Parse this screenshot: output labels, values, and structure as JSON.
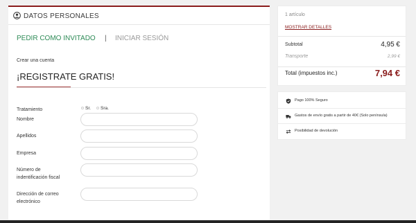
{
  "personal": {
    "title": "DATOS PERSONALES",
    "tabs": {
      "guest": "PEDIR COMO INVITADO",
      "separator": "|",
      "login": "INICIAR SESIÓN"
    },
    "create_account": "Crear una cuenta",
    "headline": "¡REGISTRATE GRATIS!",
    "form": {
      "title_label": "Tratamiento",
      "title_options": [
        "Sr.",
        "Sra."
      ],
      "nombre_label": "Nombre",
      "apellidos_label": "Apellidos",
      "empresa_label": "Empresa",
      "nif_label_1": "Número de",
      "nif_label_2": "indentificación fiscal",
      "email_label_1": "Dirección de correo",
      "email_label_2": "electrónico"
    }
  },
  "cart": {
    "count": "1 artículo",
    "show_details": "MOSTRAR DETALLES",
    "subtotal_label": "Subtotal",
    "subtotal_value": "4,95 €",
    "shipping_label": "Transporte",
    "shipping_value": "2,99 €",
    "total_label": "Total (impuestos inc.)",
    "total_value": "7,94 €"
  },
  "reassurance": [
    {
      "icon": "shield-icon",
      "text": "Pago 100% Seguro"
    },
    {
      "icon": "truck-icon",
      "text": "Gastos de envío gratis a partir de 40€ (Solo península)"
    },
    {
      "icon": "exchange-icon",
      "text": "Posibilidad de devolución"
    }
  ],
  "colors": {
    "accent": "#8a1c1c",
    "guest_tab": "#2e8b57"
  }
}
